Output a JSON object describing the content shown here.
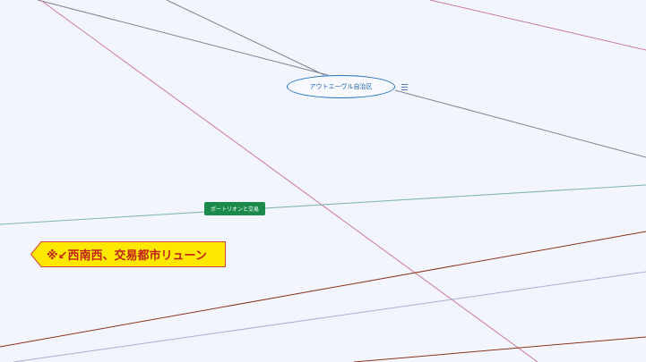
{
  "mindmap": {
    "nodes": {
      "oval": {
        "label": "アウトエーヴル自治区"
      },
      "green": {
        "label": "ポートリオンと交易"
      },
      "banner": {
        "label": "※↙西南西、交易都市リューン"
      }
    },
    "menu_icon": "hamburger-menu-icon"
  },
  "colors": {
    "background": "#f2f4fe",
    "oval_border": "#1f6fbf",
    "green_node": "#1b8b4b",
    "banner_fill": "#ffe800",
    "banner_border": "#d04040",
    "banner_text": "#c0201a",
    "edge_gray": "#7f8590",
    "edge_pink": "#cc7a96",
    "edge_teal": "#7fb7a5",
    "edge_brown": "#8a3418",
    "edge_lavender": "#aab0cc"
  }
}
